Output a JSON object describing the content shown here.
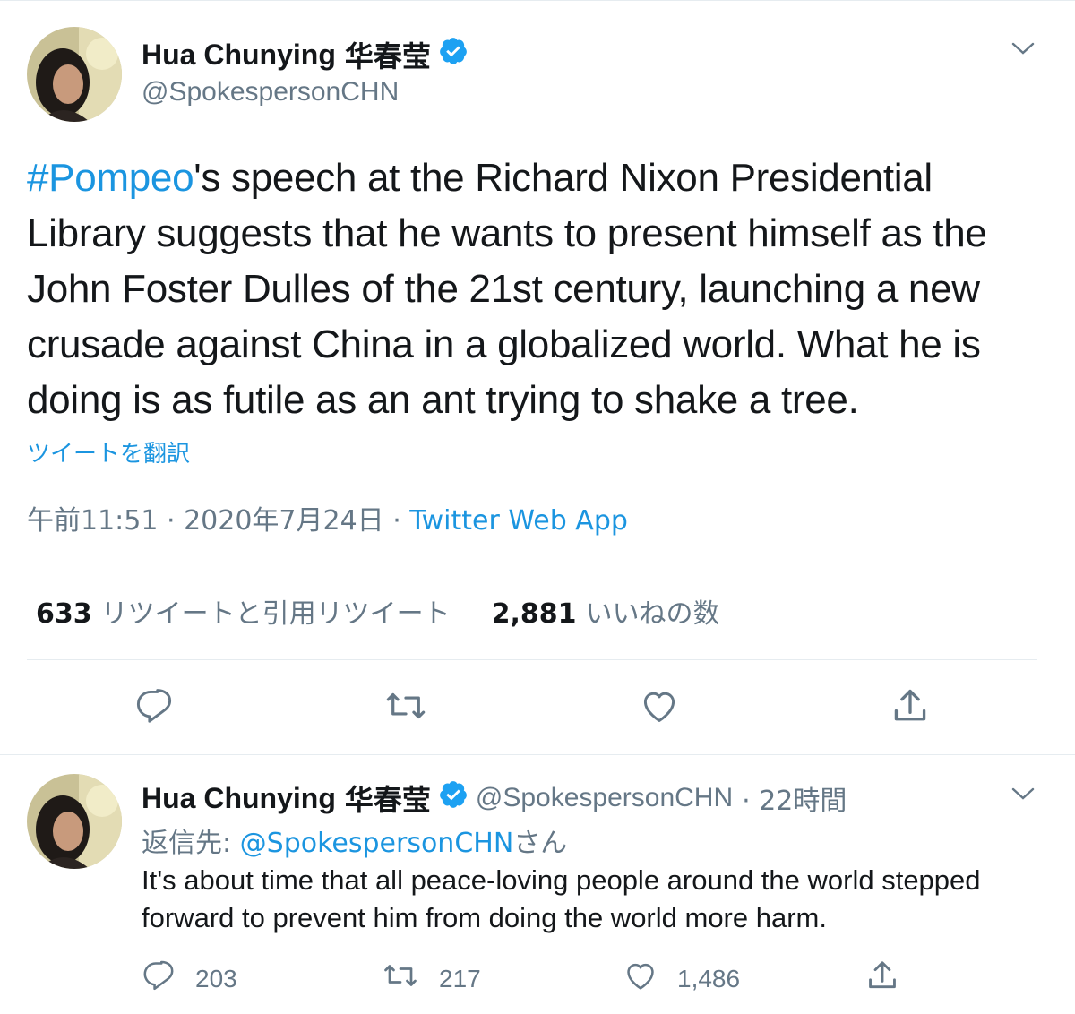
{
  "tweet": {
    "author_name": "Hua Chunying",
    "author_name_cjk": "华春莹",
    "author_handle": "@SpokespersonCHN",
    "hashtag": "#Pompeo",
    "text_after_hashtag": "'s speech at the Richard Nixon Presidential Library suggests that he wants to present himself as the John Foster Dulles of the 21st century, launching a new crusade against China in a globalized world. What he is doing is as futile as an ant trying to shake a tree.",
    "translate_label": "ツイートを翻訳",
    "timestamp": "午前11:51 · 2020年7月24日 · ",
    "source": "Twitter Web App",
    "retweets_count": "633",
    "retweets_label": "リツイートと引用リツイート",
    "likes_count": "2,881",
    "likes_label": "いいねの数"
  },
  "reply": {
    "author_name": "Hua Chunying",
    "author_name_cjk": "华春莹",
    "author_handle": "@SpokespersonCHN",
    "time": "· 22時間",
    "reply_to_label": "返信先: ",
    "reply_to_handle": "@SpokespersonCHN",
    "reply_to_suffix": "さん",
    "text": "It's about time that all peace-loving people around the world stepped forward to prevent him from doing the world more harm.",
    "reply_count": "203",
    "retweet_count": "217",
    "like_count": "1,486"
  },
  "icons": {
    "verified": "verified-badge-icon",
    "more": "chevron-down-icon",
    "reply": "reply-bubble-icon",
    "retweet": "retweet-icon",
    "like": "heart-icon",
    "share": "share-icon"
  },
  "colors": {
    "link": "#1b95e0",
    "secondary_text": "#657786",
    "divider": "#e6ecf0",
    "verified": "#1da1f2"
  }
}
